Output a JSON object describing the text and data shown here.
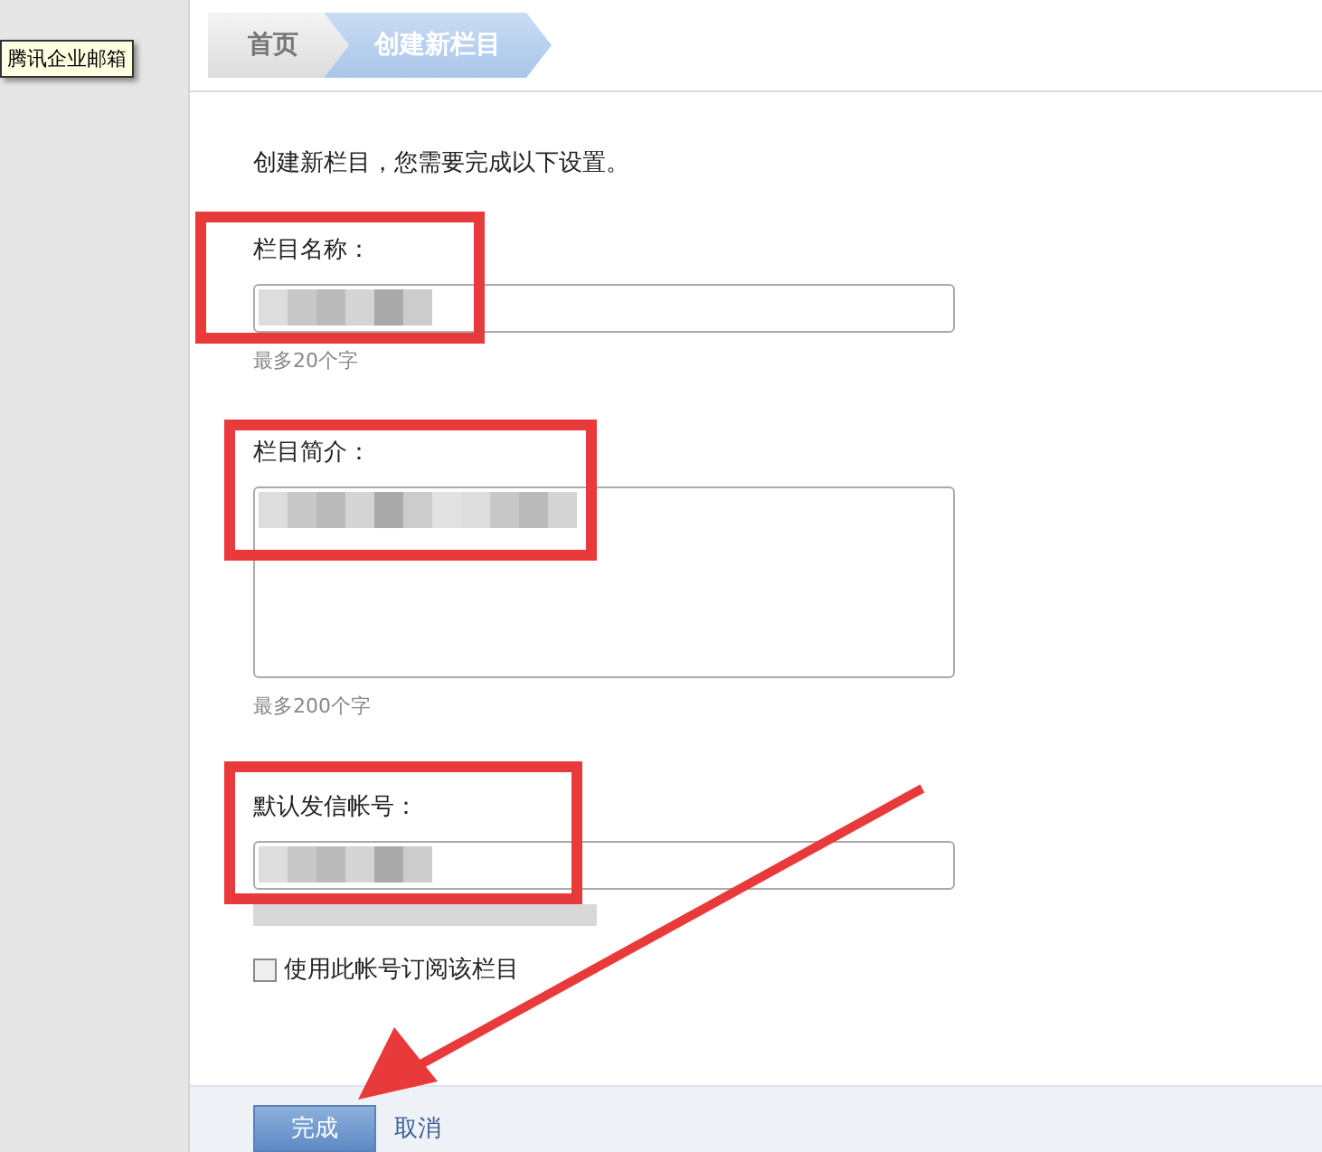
{
  "tooltip": "腾讯企业邮箱",
  "breadcrumb": [
    {
      "label": "首页",
      "selected": false
    },
    {
      "label": "创建新栏目",
      "selected": true
    }
  ],
  "intro": "创建新栏目，您需要完成以下设置。",
  "fields": [
    {
      "kind": "input",
      "label": "栏目名称：",
      "value_blurred": true,
      "hint": "最多20个字"
    },
    {
      "kind": "textarea",
      "label": "栏目简介：",
      "value_blurred": true,
      "hint": "最多200个字"
    },
    {
      "kind": "input",
      "label": "默认发信帐号：",
      "value_blurred": true,
      "hint_blurred": true
    }
  ],
  "checkbox": {
    "label": "使用此帐号订阅该栏目",
    "checked": false
  },
  "buttons": [
    {
      "label": "完成",
      "kind": "primary"
    },
    {
      "label": "取消",
      "kind": "link"
    }
  ],
  "annotations": [
    {
      "kind": "box"
    },
    {
      "kind": "box"
    },
    {
      "kind": "box"
    },
    {
      "kind": "arrow"
    }
  ]
}
